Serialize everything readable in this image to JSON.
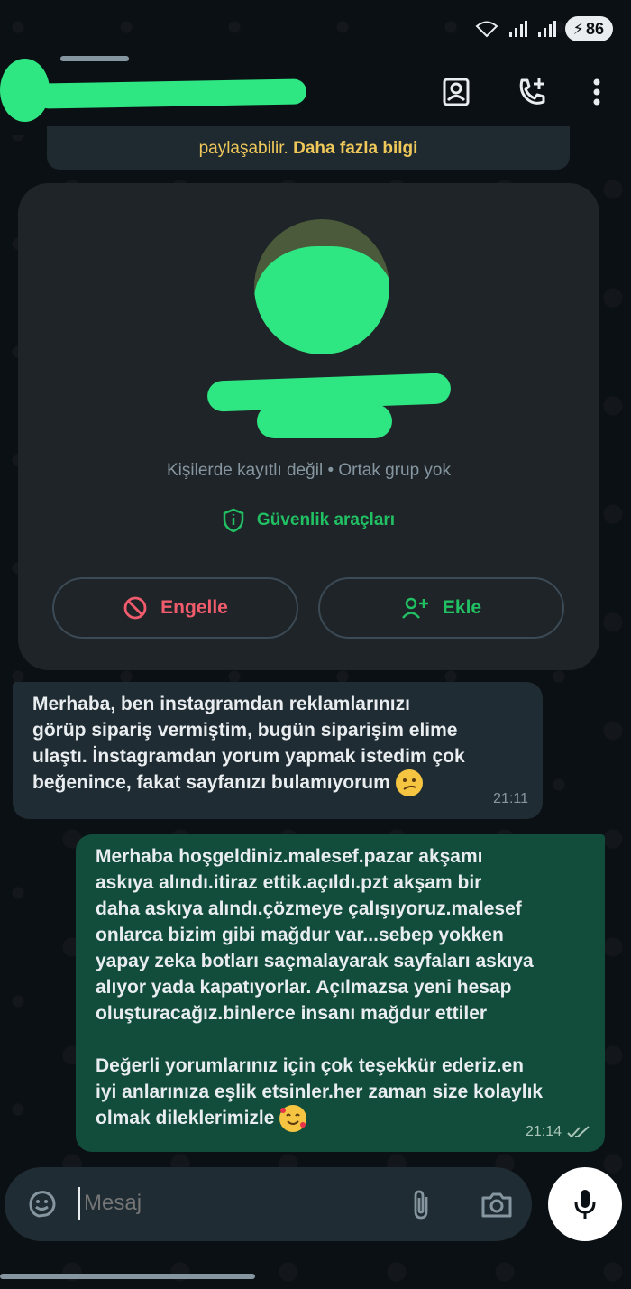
{
  "status_bar": {
    "battery": "86"
  },
  "header": {
    "icons": [
      "contact-card-icon",
      "add-call-icon",
      "more-vert-icon"
    ]
  },
  "notice": {
    "text": "paylaşabilir.",
    "link": "Daha fazla bilgi"
  },
  "contact_card": {
    "subtitle": "Kişilerde kayıtlı değil • Ortak grup yok",
    "security_tools": "Güvenlik araçları",
    "block_label": "Engelle",
    "add_label": "Ekle",
    "accent": "#21c063",
    "danger": "#f15c6d"
  },
  "messages": [
    {
      "direction": "incoming",
      "text": "Merhaba, ben instagramdan reklamlarınızı\ngörüp sipariş vermiştim, bugün siparişim elime\nulaştı. İnstagramdan yorum yapmak istedim çok\nbeğenince, fakat sayfanızı bulamıyorum",
      "emoji": "confused-face",
      "time": "21:11"
    },
    {
      "direction": "outgoing",
      "text": "Merhaba hoşgeldiniz.malesef.pazar akşamı\naskıya alındı.itiraz ettik.açıldı.pzt akşam bir\ndaha askıya alındı.çözmeye çalışıyoruz.malesef\nonlarca bizim gibi mağdur var...sebep yokken\nyapay zeka botları saçmalayarak sayfaları askıya\nalıyor yada kapatıyorlar. Açılmazsa yeni hesap\noluşturacağız.binlerce insanı mağdur ettiler\n\nDeğerli yorumlarınız için çok teşekkür ederiz.en\niyi anlarınıza eşlik etsinler.her zaman size kolaylık\nolmak dileklerimizle",
      "emoji": "smiling-face-with-hearts",
      "time": "21:14",
      "status": "read"
    }
  ],
  "composer": {
    "placeholder": "Mesaj"
  },
  "colors": {
    "background": "#0b1014",
    "incoming_bubble": "#1f2c33",
    "outgoing_bubble": "#114d3a"
  }
}
